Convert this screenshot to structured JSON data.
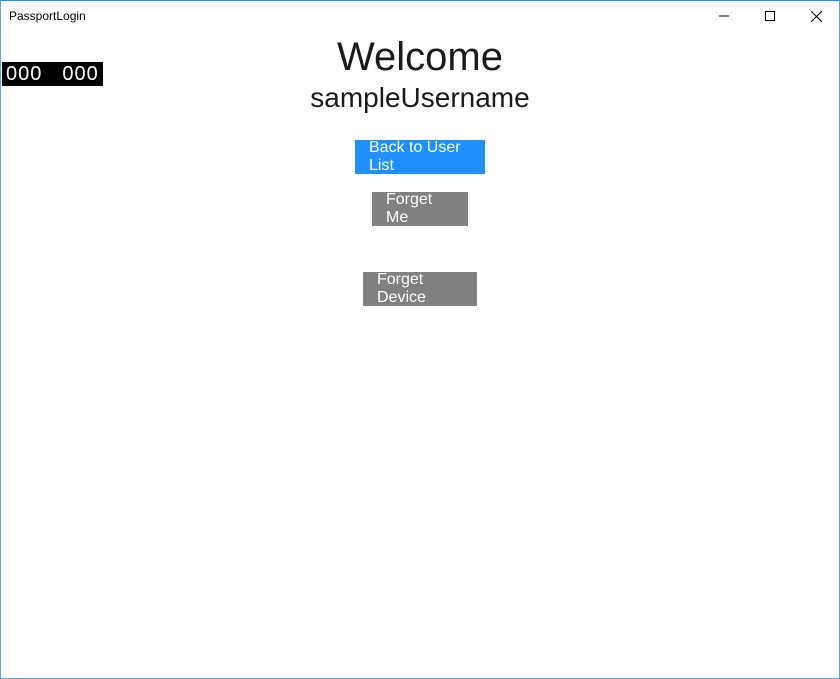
{
  "window": {
    "title": "PassportLogin"
  },
  "debug": {
    "counter_left": "000",
    "counter_right": "000"
  },
  "main": {
    "welcome_title": "Welcome",
    "username": "sampleUsername",
    "buttons": {
      "back_to_user_list": "Back to User List",
      "forget_me": "Forget Me",
      "forget_device": "Forget Device"
    }
  },
  "colors": {
    "primary": "#1e90ff",
    "secondary": "#808080"
  }
}
